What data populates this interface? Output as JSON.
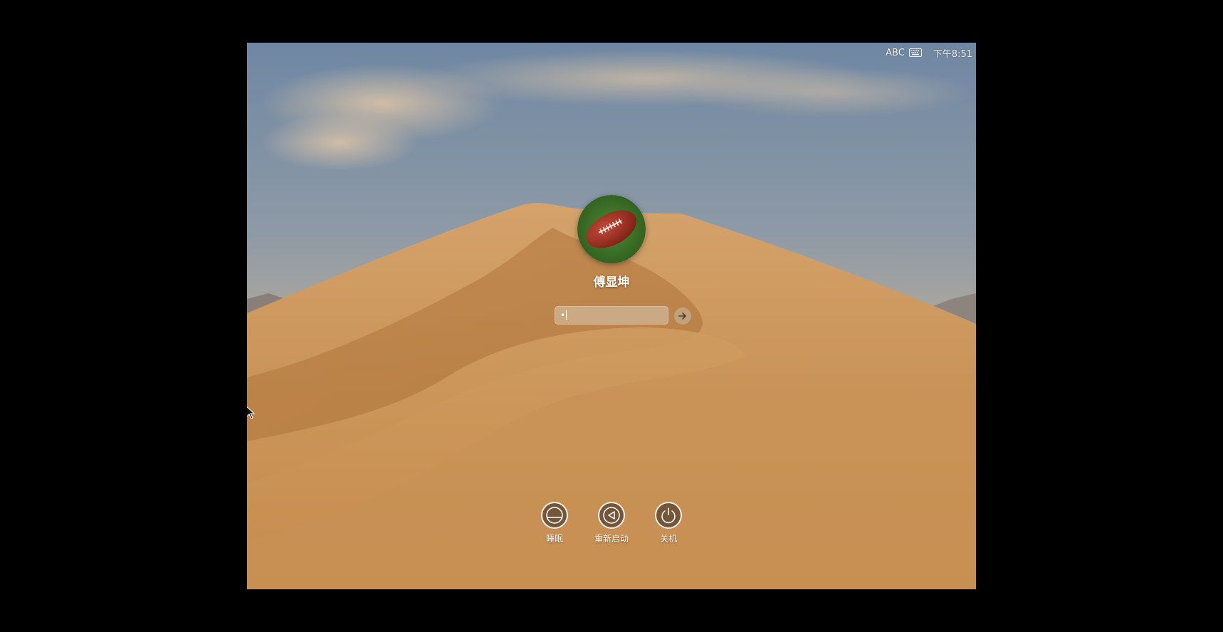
{
  "menubar": {
    "input_source": "ABC",
    "input_source_icon": "keyboard-icon",
    "clock": "下午8:51"
  },
  "login": {
    "user_name": "傅显坤",
    "avatar_icon": "american-football-icon",
    "password_mask": "•",
    "submit_icon": "arrow-right-icon"
  },
  "power_actions": {
    "sleep": {
      "label": "睡眠",
      "icon": "sleep-icon"
    },
    "restart": {
      "label": "重新启动",
      "icon": "restart-icon"
    },
    "shutdown": {
      "label": "关机",
      "icon": "power-icon"
    }
  }
}
